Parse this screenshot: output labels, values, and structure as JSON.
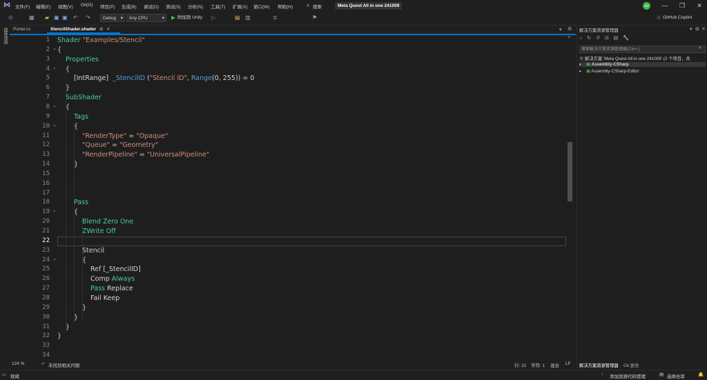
{
  "menu": [
    "文件(F)",
    "编辑(E)",
    "视图(V)",
    "Git(G)",
    "项目(P)",
    "生成(B)",
    "调试(D)",
    "测试(S)",
    "分析(N)",
    "工具(T)",
    "扩展(X)",
    "窗口(W)",
    "帮助(H)"
  ],
  "search_label": "搜索",
  "project_name": "Meta Quest All in one 241009",
  "avatar_initials": "XD",
  "window_controls": {
    "min": "—",
    "max": "❐",
    "close": "✕"
  },
  "toolbar": {
    "config": "Debug",
    "platform": "Any CPU",
    "attach": "附加到 Unity",
    "copilot": "GitHub Copilot"
  },
  "left_strip_label": "器管理器",
  "tabs": [
    {
      "label": "Portal.cs",
      "active": false
    },
    {
      "label": "StencilShader.shader",
      "active": true
    }
  ],
  "editor": {
    "zoom": "124 %",
    "issues": "未找到相关问题",
    "line_col": "行: 22",
    "char": "字符: 1",
    "mode": "混合",
    "eol": "LF"
  },
  "code_lines": [
    {
      "n": "1",
      "indent": 0,
      "tokens": [
        {
          "t": "Shader ",
          "c": "kw"
        },
        {
          "t": "\"Examples/Stencil\"",
          "c": "str"
        }
      ]
    },
    {
      "n": "2",
      "indent": 0,
      "tokens": [
        {
          "t": "{",
          "c": "plain"
        }
      ]
    },
    {
      "n": "3",
      "indent": 1,
      "tokens": [
        {
          "t": "Properties",
          "c": "kw"
        }
      ]
    },
    {
      "n": "4",
      "indent": 1,
      "tokens": [
        {
          "t": "{",
          "c": "plain"
        }
      ]
    },
    {
      "n": "5",
      "indent": 2,
      "tokens": [
        {
          "t": "[IntRange]  ",
          "c": "plain"
        },
        {
          "t": "_StencilID",
          "c": "blue"
        },
        {
          "t": " (",
          "c": "plain"
        },
        {
          "t": "\"Stencil ID\"",
          "c": "str"
        },
        {
          "t": ", ",
          "c": "plain"
        },
        {
          "t": "Range",
          "c": "blue"
        },
        {
          "t": "(0, 255)) = 0",
          "c": "plain"
        }
      ]
    },
    {
      "n": "6",
      "indent": 1,
      "tokens": [
        {
          "t": "}",
          "c": "plain"
        }
      ]
    },
    {
      "n": "7",
      "indent": 1,
      "tokens": [
        {
          "t": "SubShader",
          "c": "kw"
        }
      ]
    },
    {
      "n": "8",
      "indent": 1,
      "tokens": [
        {
          "t": "{",
          "c": "plain"
        }
      ]
    },
    {
      "n": "9",
      "indent": 2,
      "tokens": [
        {
          "t": "Tags",
          "c": "kw"
        }
      ]
    },
    {
      "n": "10",
      "indent": 2,
      "tokens": [
        {
          "t": "{",
          "c": "plain"
        }
      ]
    },
    {
      "n": "11",
      "indent": 3,
      "tokens": [
        {
          "t": "\"RenderType\"",
          "c": "str"
        },
        {
          "t": " = ",
          "c": "plain"
        },
        {
          "t": "\"Opaque\"",
          "c": "str"
        }
      ]
    },
    {
      "n": "12",
      "indent": 3,
      "tokens": [
        {
          "t": "\"Queue\"",
          "c": "str"
        },
        {
          "t": " = ",
          "c": "plain"
        },
        {
          "t": "\"Geometry\"",
          "c": "str"
        }
      ]
    },
    {
      "n": "13",
      "indent": 3,
      "tokens": [
        {
          "t": "\"RenderPipeline\"",
          "c": "str"
        },
        {
          "t": " = ",
          "c": "plain"
        },
        {
          "t": "\"UniversalPipeline\"",
          "c": "str"
        }
      ]
    },
    {
      "n": "14",
      "indent": 2,
      "tokens": [
        {
          "t": "}",
          "c": "plain"
        }
      ]
    },
    {
      "n": "15",
      "indent": 0,
      "tokens": []
    },
    {
      "n": "16",
      "indent": 0,
      "tokens": []
    },
    {
      "n": "17",
      "indent": 0,
      "tokens": []
    },
    {
      "n": "18",
      "indent": 2,
      "tokens": [
        {
          "t": "Pass",
          "c": "kw"
        }
      ]
    },
    {
      "n": "19",
      "indent": 2,
      "tokens": [
        {
          "t": "{",
          "c": "plain"
        }
      ]
    },
    {
      "n": "20",
      "indent": 3,
      "tokens": [
        {
          "t": "Blend Zero One",
          "c": "kw"
        }
      ]
    },
    {
      "n": "21",
      "indent": 3,
      "tokens": [
        {
          "t": "ZWrite Off",
          "c": "kw"
        }
      ]
    },
    {
      "n": "22",
      "indent": 0,
      "tokens": []
    },
    {
      "n": "23",
      "indent": 3,
      "tokens": [
        {
          "t": "Stencil",
          "c": "plain"
        }
      ]
    },
    {
      "n": "24",
      "indent": 3,
      "tokens": [
        {
          "t": "{",
          "c": "plain"
        }
      ]
    },
    {
      "n": "25",
      "indent": 4,
      "tokens": [
        {
          "t": "Ref [_StencilID]",
          "c": "plain"
        }
      ]
    },
    {
      "n": "26",
      "indent": 4,
      "tokens": [
        {
          "t": "Comp ",
          "c": "plain"
        },
        {
          "t": "Always",
          "c": "kw"
        }
      ]
    },
    {
      "n": "27",
      "indent": 4,
      "tokens": [
        {
          "t": "Pass",
          "c": "kw"
        },
        {
          "t": " Replace",
          "c": "plain"
        }
      ]
    },
    {
      "n": "28",
      "indent": 4,
      "tokens": [
        {
          "t": "Fail Keep",
          "c": "plain"
        }
      ]
    },
    {
      "n": "29",
      "indent": 3,
      "tokens": [
        {
          "t": "}",
          "c": "plain"
        }
      ]
    },
    {
      "n": "30",
      "indent": 2,
      "tokens": [
        {
          "t": "}",
          "c": "plain"
        }
      ]
    },
    {
      "n": "31",
      "indent": 1,
      "tokens": [
        {
          "t": "}",
          "c": "plain"
        }
      ]
    },
    {
      "n": "32",
      "indent": 0,
      "tokens": [
        {
          "t": "}",
          "c": "plain"
        }
      ]
    },
    {
      "n": "33",
      "indent": 0,
      "tokens": []
    },
    {
      "n": "34",
      "indent": 0,
      "tokens": []
    }
  ],
  "current_line": "22",
  "solution_explorer": {
    "title": "解决方案资源管理器",
    "search_placeholder": "搜索解决方案资源管理器(Ctrl+;)",
    "solution_label": "解决方案 'Meta Quest All in one 241009' (2 个项目，共",
    "projects": [
      "Assembly-CSharp",
      "Assembly-CSharp-Editor"
    ],
    "bottom_tabs": [
      "解决方案资源管理器",
      "Git 更改"
    ]
  },
  "statusbar": {
    "ready": "就绪",
    "add_source": "添加到源代码管理",
    "select_repo": "选择仓库"
  },
  "colors": {
    "accent": "#0078d4",
    "keyword": "#4ec9b0",
    "string": "#ce9178",
    "blue": "#569cd6"
  }
}
